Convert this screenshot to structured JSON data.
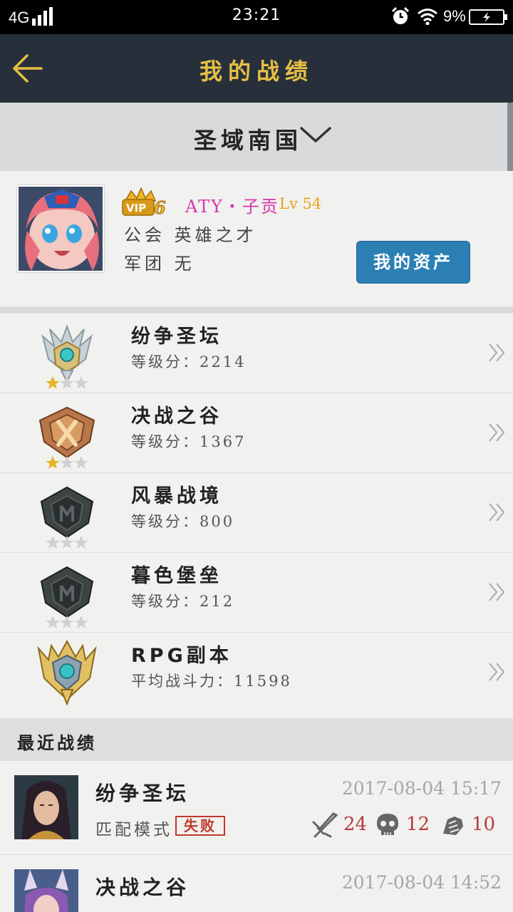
{
  "status_bar": {
    "network": "4G",
    "time": "23:21",
    "battery": "9%"
  },
  "header": {
    "title": "我的战绩"
  },
  "server": {
    "name": "圣域南国"
  },
  "profile": {
    "vip_level": "6",
    "vip_text": "VIP",
    "name": "ATY・子贡",
    "level": "Lv 54",
    "guild": "公会 英雄之才",
    "legion": "军团 无",
    "assets_button": "我的资产"
  },
  "modes": [
    {
      "name": "纷争圣坛",
      "score": "等级分：2214",
      "stars": 1,
      "emblem": "silver-gold-wing-emblem"
    },
    {
      "name": "决战之谷",
      "score": "等级分：1367",
      "stars": 1,
      "emblem": "bronze-x-emblem"
    },
    {
      "name": "风暴战境",
      "score": "等级分：800",
      "stars": 0,
      "emblem": "dark-shield-emblem"
    },
    {
      "name": "暮色堡垒",
      "score": "等级分：212",
      "stars": 0,
      "emblem": "dark-shield-emblem"
    },
    {
      "name": "RPG副本",
      "score": "平均战斗力：11598",
      "stars": null,
      "emblem": "gold-crown-emblem"
    }
  ],
  "recent": {
    "title": "最近战绩",
    "matches": [
      {
        "mode": "纷争圣坛",
        "time": "2017-08-04 15:17",
        "type": "匹配模式",
        "result": "失败",
        "kills": "24",
        "deaths": "12",
        "assists": "10"
      },
      {
        "mode": "决战之谷",
        "time": "2017-08-04 14:52"
      }
    ]
  },
  "colors": {
    "accent_gold": "#e6bf45",
    "topbar": "#27303a",
    "button_blue": "#2b7fb3",
    "loss_red": "#c0392b",
    "name_pink": "#d63aa8"
  }
}
